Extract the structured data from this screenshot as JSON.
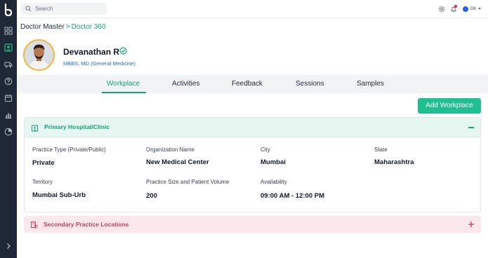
{
  "search": {
    "placeholder": "Search"
  },
  "user": {
    "initials": "DK"
  },
  "breadcrumb": {
    "root": "Doctor Master",
    "separator": ">",
    "current": "Doctor 360"
  },
  "profile": {
    "name": "Devanathan R",
    "qualification": "MBBS, MD (General Medicine)"
  },
  "tabs": [
    {
      "label": "Workplace",
      "active": true
    },
    {
      "label": "Activities",
      "active": false
    },
    {
      "label": "Feedback",
      "active": false
    },
    {
      "label": "Sessions",
      "active": false
    },
    {
      "label": "Samples",
      "active": false
    }
  ],
  "add_button": "Add Workplace",
  "primary": {
    "title": "Primary Hospital/Clinic",
    "fields": [
      {
        "label": "Practice Type (Private/Public)",
        "value": "Private"
      },
      {
        "label": "Organization Name",
        "value": "New Medical Center"
      },
      {
        "label": "City",
        "value": "Mumbai"
      },
      {
        "label": "State",
        "value": "Maharashtra"
      },
      {
        "label": "Territory",
        "value": "Mumbai Sub-Urb"
      },
      {
        "label": "Practice Size and Patient Volume",
        "value": "200"
      },
      {
        "label": "Availability",
        "value": "09:00 AM - 12:00 PM"
      }
    ]
  },
  "secondary": {
    "title": "Secondary Practice Locations"
  },
  "colors": {
    "accent": "#16a37b",
    "button": "#1fbf8f",
    "rail": "#1f2837",
    "secondary": "#c0415f"
  }
}
